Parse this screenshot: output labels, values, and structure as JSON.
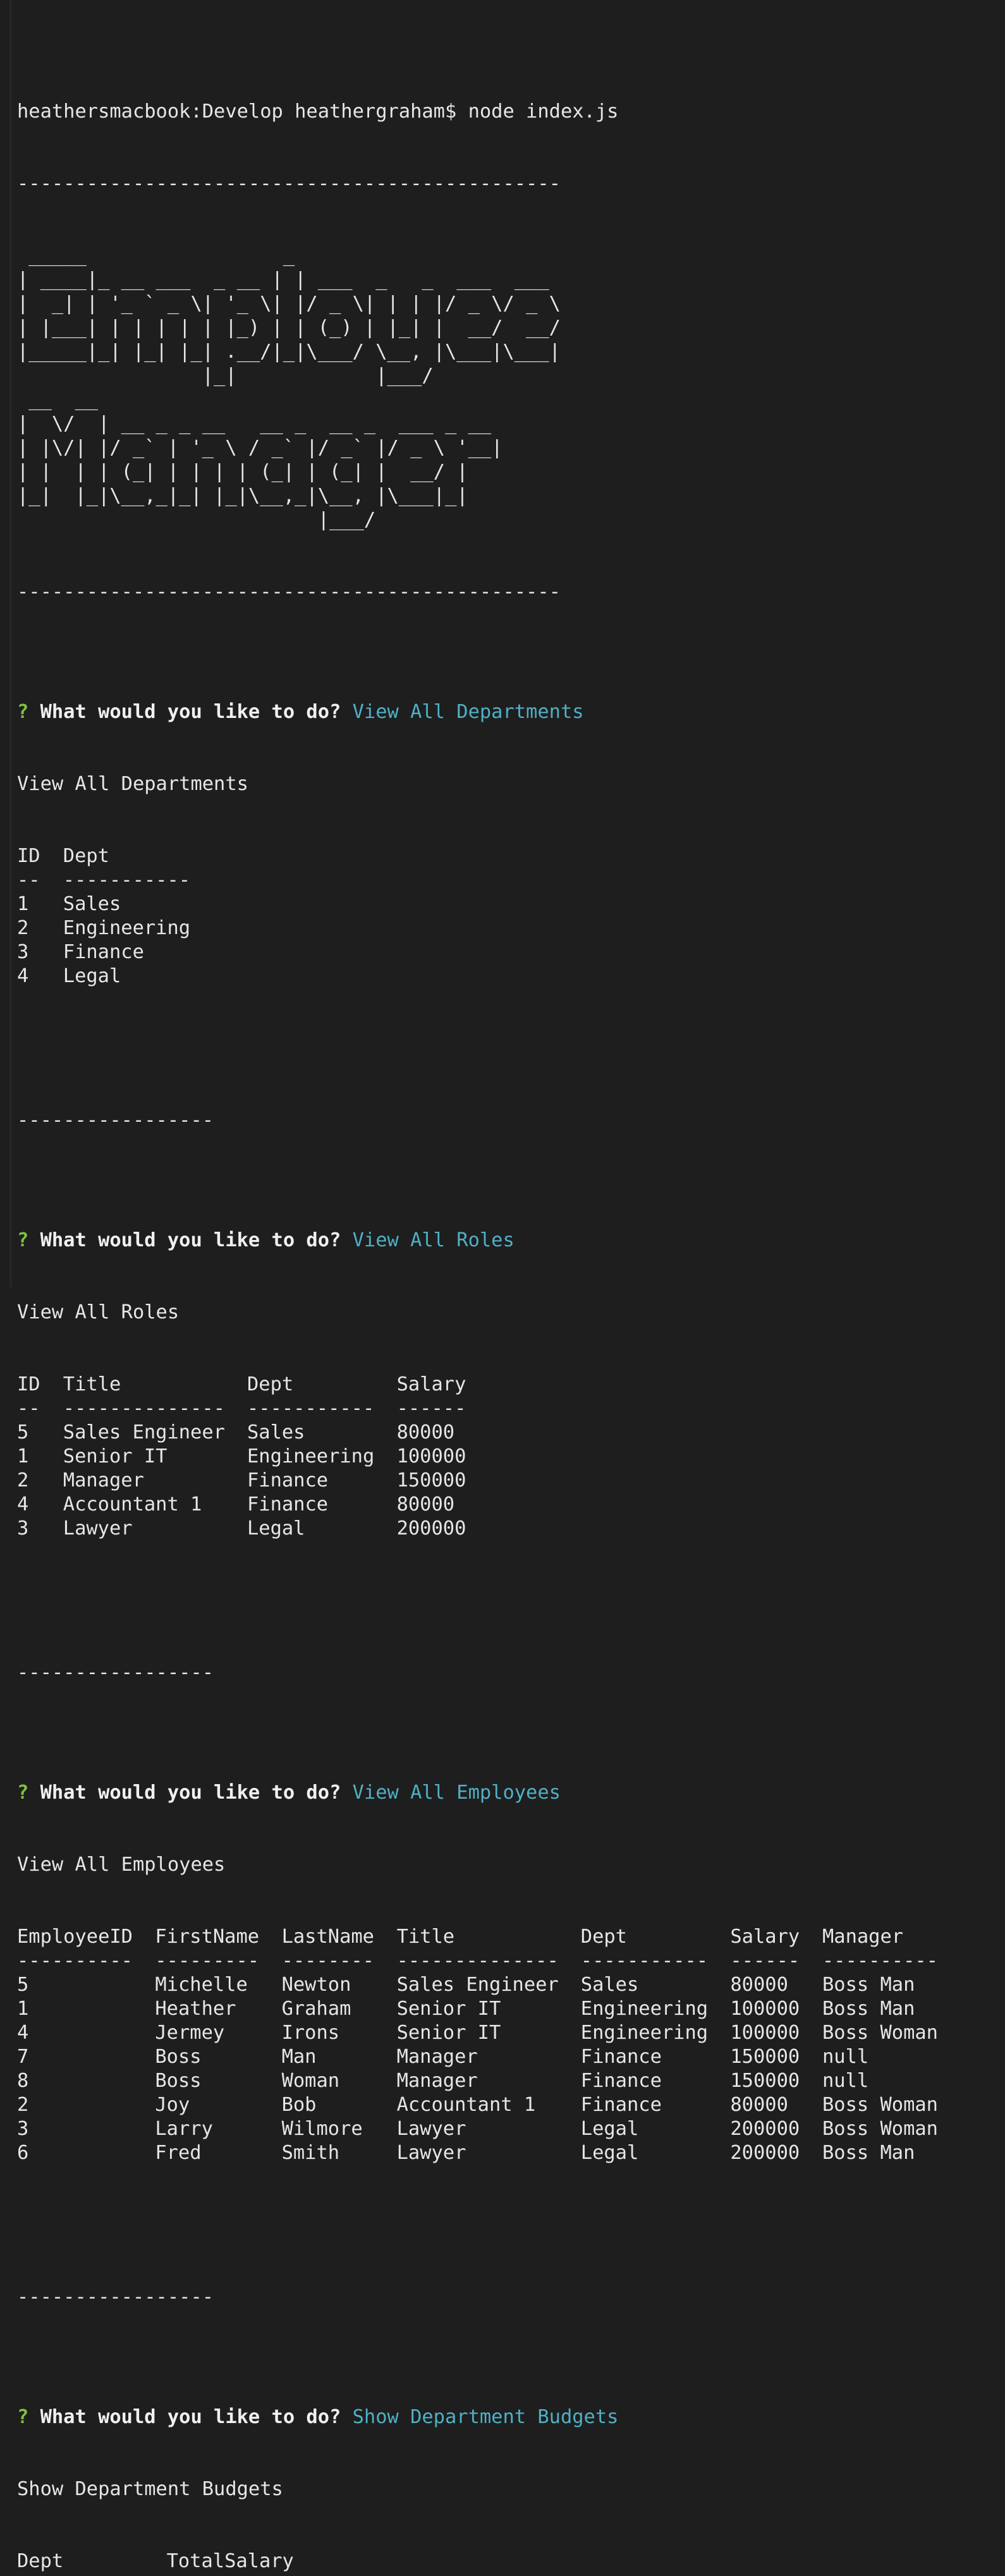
{
  "colors": {
    "background": "#1e1e1e",
    "text": "#e6e6e6",
    "prompt_marker": "#7fc241",
    "answer": "#4fb0c6"
  },
  "command_line": "heathersmacbook:Develop heathergraham$ node index.js",
  "separator_long": "-----------------------------------------------",
  "separator_short": "-----------------",
  "banner": {
    "text": "Employee Manager",
    "ascii": " _____                 _\n| ____|_ __ ___  _ __ | | ___  _   _  ___  ___\n|  _| | '_ ` _ \\| '_ \\| |/ _ \\| | | |/ _ \\/ _ \\\n| |___| | | | | | |_) | | (_) | |_| |  __/  __/\n|_____|_| |_| |_| .__/|_|\\___/ \\__, |\\___|\\___|\n                |_|            |___/\n __  __\n|  \\/  | __ _ _ __   __ _  __ _  ___ _ __\n| |\\/| |/ _` | '_ \\ / _` |/ _` |/ _ \\ '__|\n| |  | | (_| | | | | (_| | (_| |  __/ |\n|_|  |_|\\__,_|_| |_|\\__,_|\\__, |\\___|_|\n                          |___/"
  },
  "prompt_marker": "?",
  "prompt_question": "What would you like to do?",
  "departments": {
    "answer": "View All Departments",
    "echo": "View All Departments",
    "headers": [
      "ID",
      "Dept"
    ],
    "underlines": [
      "--",
      "-----------"
    ],
    "rows": [
      [
        "1",
        "Sales"
      ],
      [
        "2",
        "Engineering"
      ],
      [
        "3",
        "Finance"
      ],
      [
        "4",
        "Legal"
      ]
    ]
  },
  "roles": {
    "answer": "View All Roles",
    "echo": "View All Roles",
    "headers": [
      "ID",
      "Title",
      "Dept",
      "Salary"
    ],
    "underlines": [
      "--",
      "--------------",
      "-----------",
      "------"
    ],
    "rows": [
      [
        "5",
        "Sales Engineer",
        "Sales",
        "80000"
      ],
      [
        "1",
        "Senior IT",
        "Engineering",
        "100000"
      ],
      [
        "2",
        "Manager",
        "Finance",
        "150000"
      ],
      [
        "4",
        "Accountant 1",
        "Finance",
        "80000"
      ],
      [
        "3",
        "Lawyer",
        "Legal",
        "200000"
      ]
    ]
  },
  "employees": {
    "answer": "View All Employees",
    "echo": "View All Employees",
    "headers": [
      "EmployeeID",
      "FirstName",
      "LastName",
      "Title",
      "Dept",
      "Salary",
      "Manager"
    ],
    "underlines": [
      "----------",
      "---------",
      "--------",
      "--------------",
      "-----------",
      "------",
      "----------"
    ],
    "rows": [
      [
        "5",
        "Michelle",
        "Newton",
        "Sales Engineer",
        "Sales",
        "80000",
        "Boss Man"
      ],
      [
        "1",
        "Heather",
        "Graham",
        "Senior IT",
        "Engineering",
        "100000",
        "Boss Man"
      ],
      [
        "4",
        "Jermey",
        "Irons",
        "Senior IT",
        "Engineering",
        "100000",
        "Boss Woman"
      ],
      [
        "7",
        "Boss",
        "Man",
        "Manager",
        "Finance",
        "150000",
        "null"
      ],
      [
        "8",
        "Boss",
        "Woman",
        "Manager",
        "Finance",
        "150000",
        "null"
      ],
      [
        "2",
        "Joy",
        "Bob",
        "Accountant 1",
        "Finance",
        "80000",
        "Boss Woman"
      ],
      [
        "3",
        "Larry",
        "Wilmore",
        "Lawyer",
        "Legal",
        "200000",
        "Boss Woman"
      ],
      [
        "6",
        "Fred",
        "Smith",
        "Lawyer",
        "Legal",
        "200000",
        "Boss Man"
      ]
    ]
  },
  "budgets": {
    "answer": "Show Department Budgets",
    "echo": "Show Department Budgets",
    "headers": [
      "Dept",
      "TotalSalary"
    ]
  }
}
